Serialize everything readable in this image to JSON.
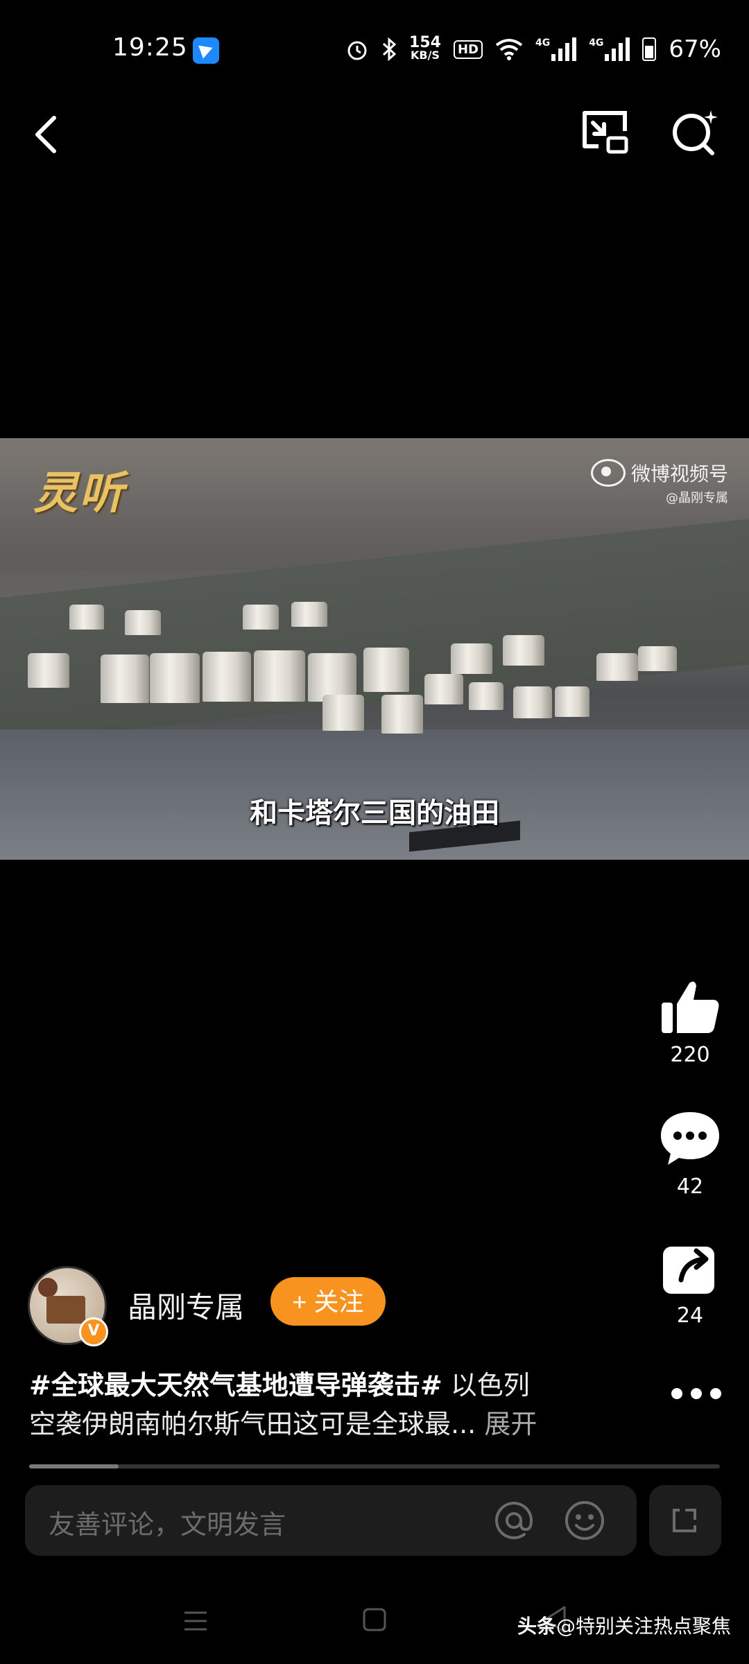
{
  "status_bar": {
    "time": "19:25",
    "net_speed_value": "154",
    "net_speed_unit": "KB/S",
    "hd_label": "HD",
    "signal1_label": "4G",
    "signal2_label": "4G",
    "battery_percent": "67%"
  },
  "video": {
    "logo_text": "灵听",
    "watermark_brand": "微博视频号",
    "watermark_handle": "@晶刚专属",
    "subtitle": "和卡塔尔三国的油田"
  },
  "actions": {
    "like_count": "220",
    "comment_count": "42",
    "share_count": "24"
  },
  "author": {
    "name": "晶刚专属",
    "follow_label": "+ 关注",
    "verified_mark": "V"
  },
  "caption": {
    "hashtag": "#全球最大天然气基地遭导弹袭击#",
    "text_line1": " 以色列",
    "text_line2": "空袭伊朗南帕尔斯气田这可是全球最...",
    "expand_label": " 展开"
  },
  "progress": {
    "fraction": 0.13
  },
  "comment_bar": {
    "placeholder": "友善评论，文明发言"
  },
  "footer_watermark": {
    "source": "头条",
    "handle": "@特别关注热点聚焦"
  },
  "colors": {
    "accent": "#f7931e",
    "background": "#000000",
    "input_bg": "#1d1d1d"
  }
}
